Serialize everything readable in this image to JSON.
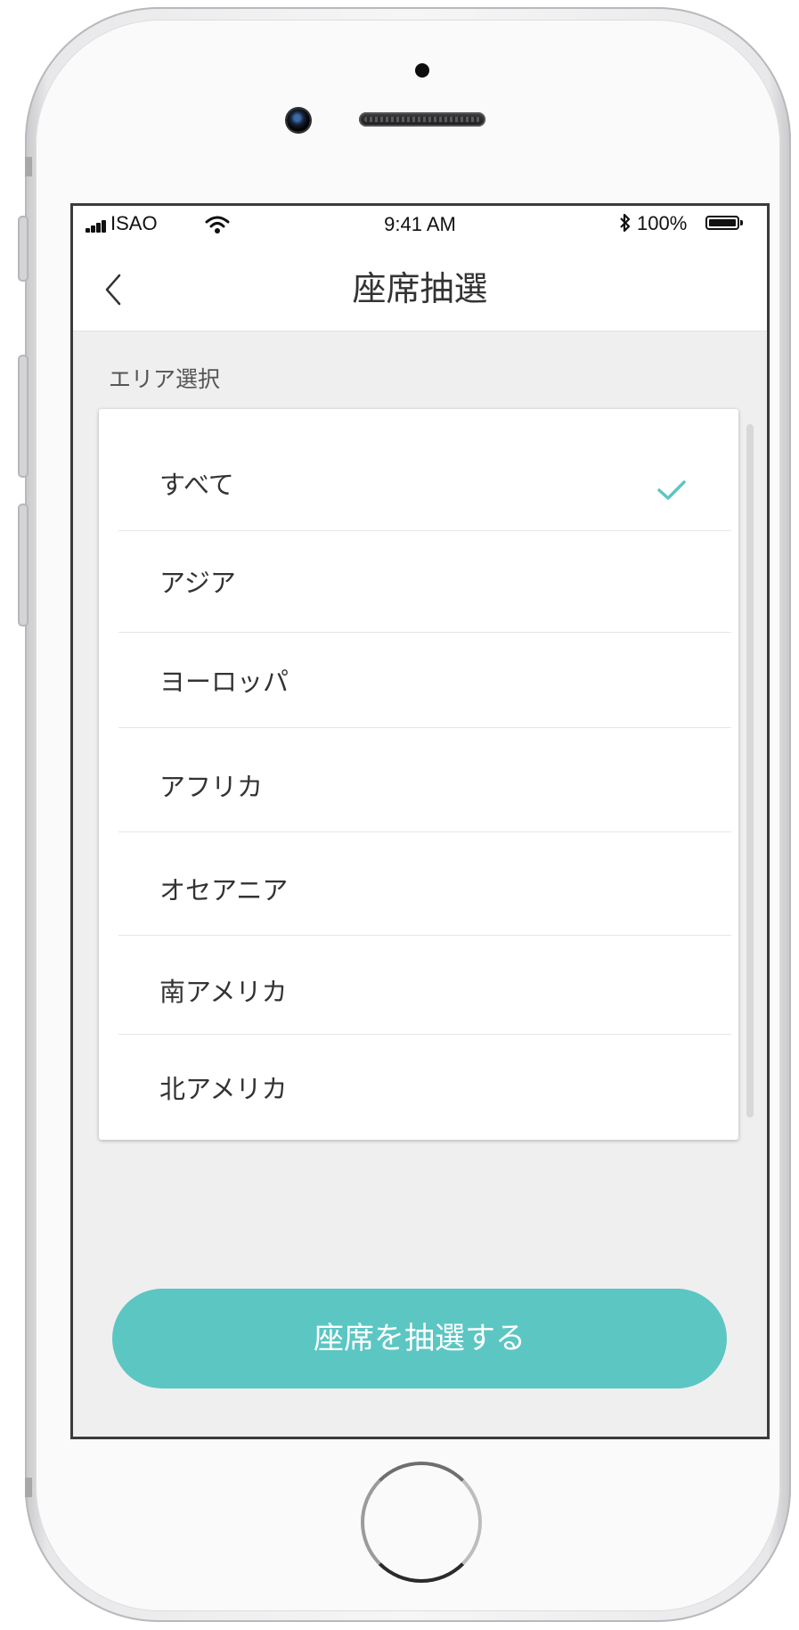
{
  "status_bar": {
    "carrier": "ISAO",
    "time": "9:41 AM",
    "battery": "100%"
  },
  "nav": {
    "title": "座席抽選"
  },
  "area_section": {
    "label": "エリア選択",
    "items": [
      {
        "label": "すべて",
        "selected": true
      },
      {
        "label": "アジア",
        "selected": false
      },
      {
        "label": "ヨーロッパ",
        "selected": false
      },
      {
        "label": "アフリカ",
        "selected": false
      },
      {
        "label": "オセアニア",
        "selected": false
      },
      {
        "label": "南アメリカ",
        "selected": false
      },
      {
        "label": "北アメリカ",
        "selected": false
      }
    ]
  },
  "cta": {
    "label": "座席を抽選する"
  },
  "colors": {
    "accent": "#5cc6c3",
    "background": "#efefef"
  },
  "icons": {
    "back": "chevron-left-icon",
    "check": "checkmark-icon",
    "wifi": "wifi-icon",
    "bluetooth": "bluetooth-icon",
    "signal": "signal-icon",
    "battery": "battery-icon"
  }
}
